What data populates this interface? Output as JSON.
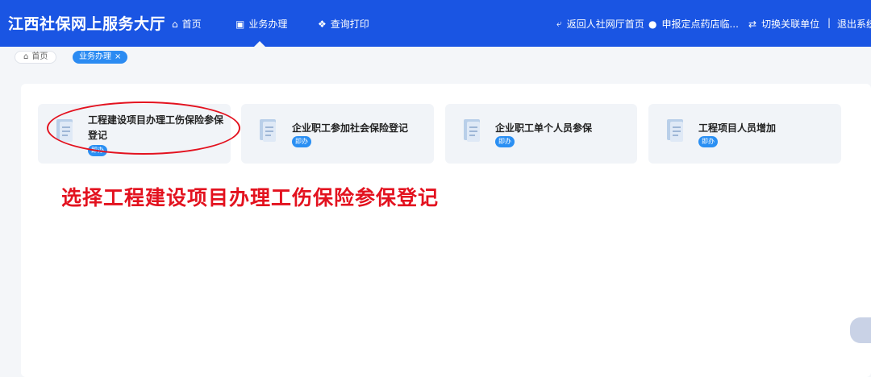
{
  "header": {
    "brand": "江西社保网上服务大厅",
    "nav": [
      {
        "label": "首页",
        "icon": "home-icon"
      },
      {
        "label": "业务办理",
        "icon": "briefcase-icon"
      },
      {
        "label": "查询打印",
        "icon": "search-print-icon"
      }
    ],
    "right_links": [
      {
        "label": "返回人社网厅首页",
        "icon": "back-arrow-icon"
      },
      {
        "label": "申报定点药店临...",
        "icon": "user-icon"
      },
      {
        "label": "切换关联单位",
        "icon": "switch-icon"
      },
      {
        "label": "退出系统",
        "icon": ""
      }
    ],
    "divider": "|"
  },
  "breadcrumb": {
    "home": "首页",
    "active": "业务办理",
    "close": "×"
  },
  "cards": [
    {
      "title_line1": "工程建设项目办理工伤保险参保",
      "title_line2": "登记",
      "tag": "即办"
    },
    {
      "title_line1": "企业职工参加社会保险登记",
      "title_line2": "",
      "tag": "即办"
    },
    {
      "title_line1": "企业职工单个人员参保",
      "title_line2": "",
      "tag": "即办"
    },
    {
      "title_line1": "工程项目人员增加",
      "title_line2": "",
      "tag": "即办"
    }
  ],
  "annotation": {
    "text": "选择工程建设项目办理工伤保险参保登记"
  },
  "colors": {
    "primary": "#1a55e3",
    "accent": "#2a8ff3",
    "annotation_red": "#e3121f",
    "card_bg": "#f1f4f8"
  }
}
